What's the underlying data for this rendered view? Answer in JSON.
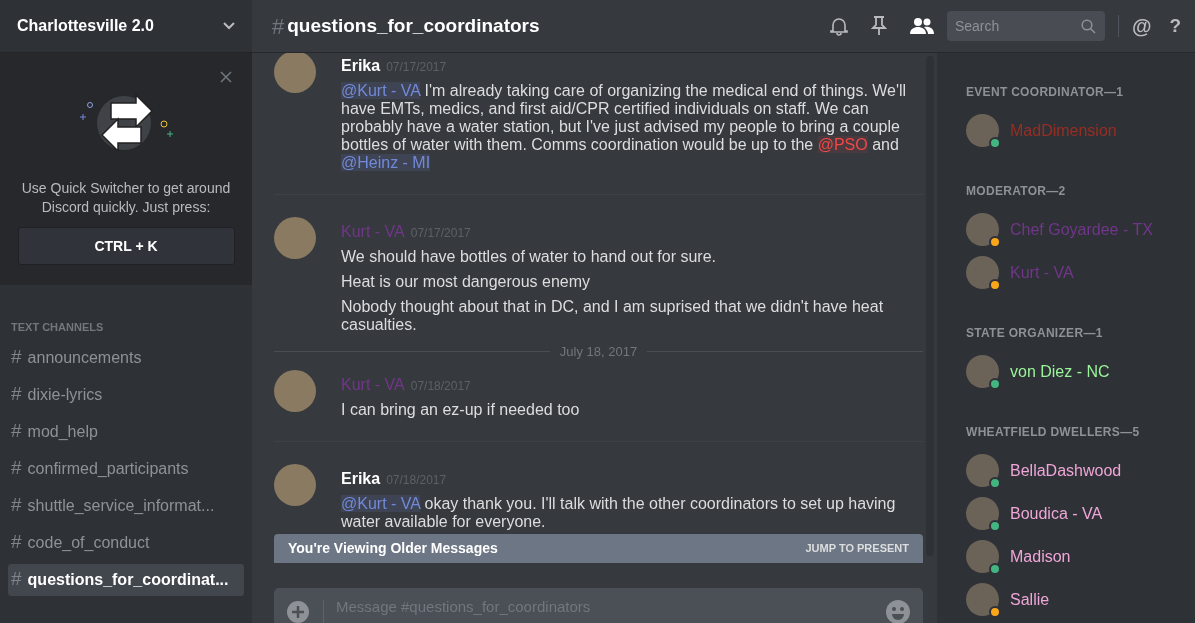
{
  "server": {
    "name": "Charlottesville 2.0"
  },
  "quick_switcher": {
    "text": "Use Quick Switcher to get around Discord quickly. Just press:",
    "shortcut": "CTRL + K"
  },
  "channel_category": "TEXT CHANNELS",
  "channels": [
    {
      "hash": "#",
      "name": "announcements",
      "selected": false
    },
    {
      "hash": "#",
      "name": "dixie-lyrics",
      "selected": false
    },
    {
      "hash": "#",
      "name": "mod_help",
      "selected": false
    },
    {
      "hash": "#",
      "name": "confirmed_participants",
      "selected": false
    },
    {
      "hash": "#",
      "name": "shuttle_service_informat...",
      "selected": false
    },
    {
      "hash": "#",
      "name": "code_of_conduct",
      "selected": false
    },
    {
      "hash": "#",
      "name": "questions_for_coordinat...",
      "selected": true
    }
  ],
  "header": {
    "hash": "#",
    "channel": "questions_for_coordinators",
    "search_placeholder": "Search",
    "mention_symbol": "@",
    "help_symbol": "?"
  },
  "messages": [
    {
      "kind": "message",
      "author": "Erika",
      "color": "#ffffff",
      "timestamp": "07/17/2017",
      "lines": [
        [
          {
            "kind": "mention",
            "text": "@Kurt - VA"
          },
          {
            "kind": "text",
            "text": " I'm already taking care of organizing the medical end of things. We'll have EMTs, medics, and first aid/CPR certified individuals on staff. We can probably have a water station, but I've just advised my people to bring a couple bottles of water with them. Comms coordination would be up to the "
          },
          {
            "kind": "role_mention",
            "text": "@PSO"
          },
          {
            "kind": "text",
            "text": " and "
          },
          {
            "kind": "mention",
            "text": "@Heinz - MI"
          }
        ]
      ]
    },
    {
      "kind": "message",
      "author": "Kurt - VA",
      "color": "#71368a",
      "timestamp": "07/17/2017",
      "lines": [
        [
          {
            "kind": "text",
            "text": "We should have bottles of water to hand out for sure."
          }
        ],
        [
          {
            "kind": "text",
            "text": "Heat is our most dangerous enemy"
          }
        ],
        [
          {
            "kind": "text",
            "text": "Nobody thought about that in DC, and I am suprised that we didn't have heat casualties."
          }
        ]
      ]
    },
    {
      "kind": "date",
      "text": "July 18, 2017"
    },
    {
      "kind": "message",
      "author": "Kurt - VA",
      "color": "#71368a",
      "timestamp": "07/18/2017",
      "lines": [
        [
          {
            "kind": "text",
            "text": "I can bring an ez-up if needed too"
          }
        ]
      ]
    },
    {
      "kind": "message",
      "author": "Erika",
      "color": "#ffffff",
      "timestamp": "07/18/2017",
      "lines": [
        [
          {
            "kind": "mention",
            "text": "@Kurt - VA"
          },
          {
            "kind": "text",
            "text": " okay thank you. I'll talk with the other coordinators to set up having water available for everyone."
          }
        ]
      ]
    }
  ],
  "older_messages_bar": {
    "text": "You're Viewing Older Messages",
    "action": "JUMP TO PRESENT"
  },
  "composer": {
    "placeholder": "Message #questions_for_coordinators"
  },
  "member_groups": [
    {
      "title": "EVENT COORDINATOR—1",
      "members": [
        {
          "name": "MadDimension",
          "color": "#992d22",
          "idle": false
        }
      ]
    },
    {
      "title": "MODERATOR—2",
      "members": [
        {
          "name": "Chef Goyardee - TX",
          "color": "#71368a",
          "idle": true
        },
        {
          "name": "Kurt - VA",
          "color": "#71368a",
          "idle": true
        }
      ]
    },
    {
      "title": "STATE ORGANIZER—1",
      "members": [
        {
          "name": "von Diez - NC",
          "color": "#9af59a",
          "idle": false
        }
      ]
    },
    {
      "title": "WHEATFIELD DWELLERS—5",
      "members": [
        {
          "name": "BellaDashwood",
          "color": "#f0a6d8",
          "idle": false
        },
        {
          "name": "Boudica - VA",
          "color": "#f0a6d8",
          "idle": false
        },
        {
          "name": "Madison",
          "color": "#f0a6d8",
          "idle": false
        },
        {
          "name": "Sallie",
          "color": "#f0a6d8",
          "idle": true
        }
      ]
    }
  ]
}
